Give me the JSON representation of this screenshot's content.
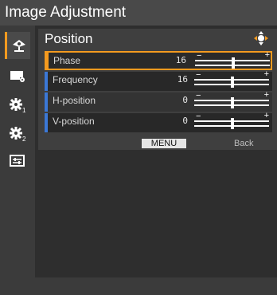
{
  "window": {
    "title": "Image Adjustment"
  },
  "sidebar": {
    "items": [
      {
        "icon": "picture-icon",
        "active": true
      },
      {
        "icon": "display-settings-icon",
        "active": false
      },
      {
        "icon": "gear-1-icon",
        "active": false
      },
      {
        "icon": "gear-2-icon",
        "active": false
      },
      {
        "icon": "sliders-icon",
        "active": false
      }
    ]
  },
  "section": {
    "title": "Position",
    "nav_icon": "navigation-arrows-icon"
  },
  "rows": [
    {
      "label": "Phase",
      "value": "16",
      "level": 0.5,
      "selected": true
    },
    {
      "label": "Frequency",
      "value": "16",
      "level": 0.5,
      "selected": false
    },
    {
      "label": "H-position",
      "value": "0",
      "level": 0.5,
      "selected": false
    },
    {
      "label": "V-position",
      "value": "0",
      "level": 0.5,
      "selected": false
    }
  ],
  "footer": {
    "menu_label": "MENU",
    "back_label": "Back"
  },
  "colors": {
    "accent": "#f39a1f",
    "row_marker": "#3b78d6"
  }
}
